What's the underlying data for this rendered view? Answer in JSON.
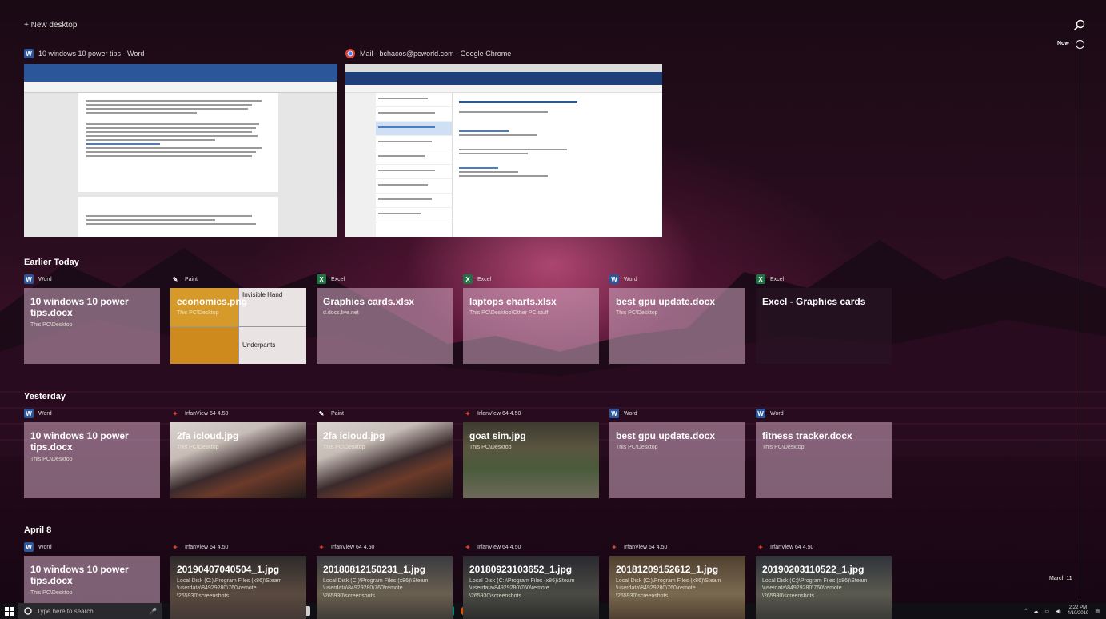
{
  "topbar": {
    "new_desktop": "+ New desktop"
  },
  "windows": [
    {
      "title": "10 windows 10 power tips - Word",
      "app": "Word"
    },
    {
      "title": "Mail - bchacos@pcworld.com - Google Chrome",
      "app": "Chrome"
    }
  ],
  "sections": [
    {
      "title": "Earlier Today",
      "cards": [
        {
          "app": "Word",
          "title": "10 windows 10 power tips.docx",
          "path": "This PC\\Desktop"
        },
        {
          "app": "Paint",
          "title": "economics.png",
          "path": "This PC\\Desktop",
          "labels": [
            "Invisible Hand",
            "Underpants"
          ]
        },
        {
          "app": "Excel",
          "title": "Graphics cards.xlsx",
          "path": "d.docs.live.net"
        },
        {
          "app": "Excel",
          "title": "laptops charts.xlsx",
          "path": "This PC\\Desktop\\Other PC stuff"
        },
        {
          "app": "Word",
          "title": "best gpu update.docx",
          "path": "This PC\\Desktop"
        },
        {
          "app": "Excel",
          "title": "Excel - Graphics cards",
          "path": ""
        }
      ]
    },
    {
      "title": "Yesterday",
      "cards": [
        {
          "app": "Word",
          "title": "10 windows 10 power tips.docx",
          "path": "This PC\\Desktop"
        },
        {
          "app": "IrfanView 64 4.50",
          "title": "2fa icloud.jpg",
          "path": "This PC\\Desktop"
        },
        {
          "app": "Paint",
          "title": "2fa icloud.jpg",
          "path": "This PC\\Desktop"
        },
        {
          "app": "IrfanView 64 4.50",
          "title": "goat sim.jpg",
          "path": "This PC\\Desktop"
        },
        {
          "app": "Word",
          "title": "best gpu update.docx",
          "path": "This PC\\Desktop"
        },
        {
          "app": "Word",
          "title": "fitness tracker.docx",
          "path": "This PC\\Desktop"
        }
      ]
    },
    {
      "title": "April 8",
      "cards": [
        {
          "app": "Word",
          "title": "10 windows 10 power tips.docx",
          "path": "This PC\\Desktop"
        },
        {
          "app": "IrfanView 64 4.50",
          "title": "20190407040504_1.jpg",
          "path": "Local Disk (C:)\\Program Files (x86)\\Steam\n\\userdata\\84929280\\760\\remote\n\\265930\\screenshots"
        },
        {
          "app": "IrfanView 64 4.50",
          "title": "20180812150231_1.jpg",
          "path": "Local Disk (C:)\\Program Files (x86)\\Steam\n\\userdata\\84929280\\760\\remote\n\\265930\\screenshots"
        },
        {
          "app": "IrfanView 64 4.50",
          "title": "20180923103652_1.jpg",
          "path": "Local Disk (C:)\\Program Files (x86)\\Steam\n\\userdata\\84929280\\760\\remote\n\\265930\\screenshots"
        },
        {
          "app": "IrfanView 64 4.50",
          "title": "20181209152612_1.jpg",
          "path": "Local Disk (C:)\\Program Files (x86)\\Steam\n\\userdata\\84929280\\760\\remote\n\\265930\\screenshots"
        },
        {
          "app": "IrfanView 64 4.50",
          "title": "20190203110522_1.jpg",
          "path": "Local Disk (C:)\\Program Files (x86)\\Steam\n\\userdata\\84929280\\760\\remote\n\\265930\\screenshots"
        }
      ]
    }
  ],
  "timeline": {
    "now": "Now",
    "march": "March 11"
  },
  "taskbar": {
    "search_placeholder": "Type here to search",
    "time": "2:22 PM",
    "date": "4/10/2019"
  },
  "colors": {
    "word": "#2b579a",
    "excel": "#217346",
    "irfanview": "#e0402a",
    "accent": "#d88ab0"
  }
}
